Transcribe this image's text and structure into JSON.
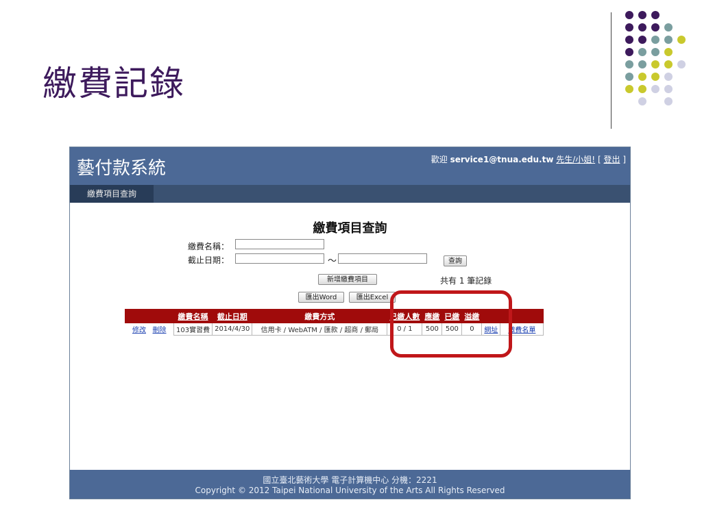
{
  "slide": {
    "title": "繳費記錄"
  },
  "decoration": {
    "dot_colors": {
      "purple": "#3d1a5c",
      "teal": "#7a9e9f",
      "yellow": "#c9c92d",
      "lavender": "#cfd0e3"
    }
  },
  "app": {
    "logo": "藝付款系統",
    "header": {
      "welcome_prefix": "歡迎",
      "user": "service1@tnua.edu.tw",
      "honorific": "先生/小姐!",
      "bracket_open": "[",
      "logout": "登出",
      "bracket_close": "]"
    },
    "nav": {
      "tab1": "繳費項目查詢"
    },
    "colors": {
      "header": "#4c6996",
      "nav": "#3a5171",
      "table_header": "#a00b0b",
      "link": "#1a3fb0"
    },
    "page_heading": "繳費項目查詢",
    "form": {
      "name_label": "繳費名稱：",
      "name_value": "",
      "date_label": "截止日期：",
      "date_from": "",
      "tilde": "～",
      "date_to": "",
      "query_button": "查詢",
      "add_button": "新增繳費項目",
      "export_word": "匯出Word",
      "export_excel": "匯出Excel",
      "record_count_text": "共有 1 筆記錄"
    },
    "table": {
      "headers": [
        "",
        "繳費名稱",
        "截止日期",
        "繳費方式",
        "已繳人數",
        "應繳",
        "已繳",
        "溢繳",
        "",
        ""
      ],
      "rows": [
        {
          "edit": "修改",
          "delete": "刪除",
          "name": "103實習費",
          "deadline": "2014/4/30",
          "methods": "信用卡 / WebATM / 匯款 / 超商 / 郵局",
          "paid_count": "0 / 1",
          "due": "500",
          "paid": "500",
          "over": "0",
          "link1": "網址",
          "link2": "繳費名單"
        }
      ]
    },
    "footer": {
      "line1": "國立臺北藝術大學 電子計算機中心 分機：2221",
      "line2": "Copyright © 2012 Taipei National University of the Arts All Rights Reserved"
    }
  }
}
